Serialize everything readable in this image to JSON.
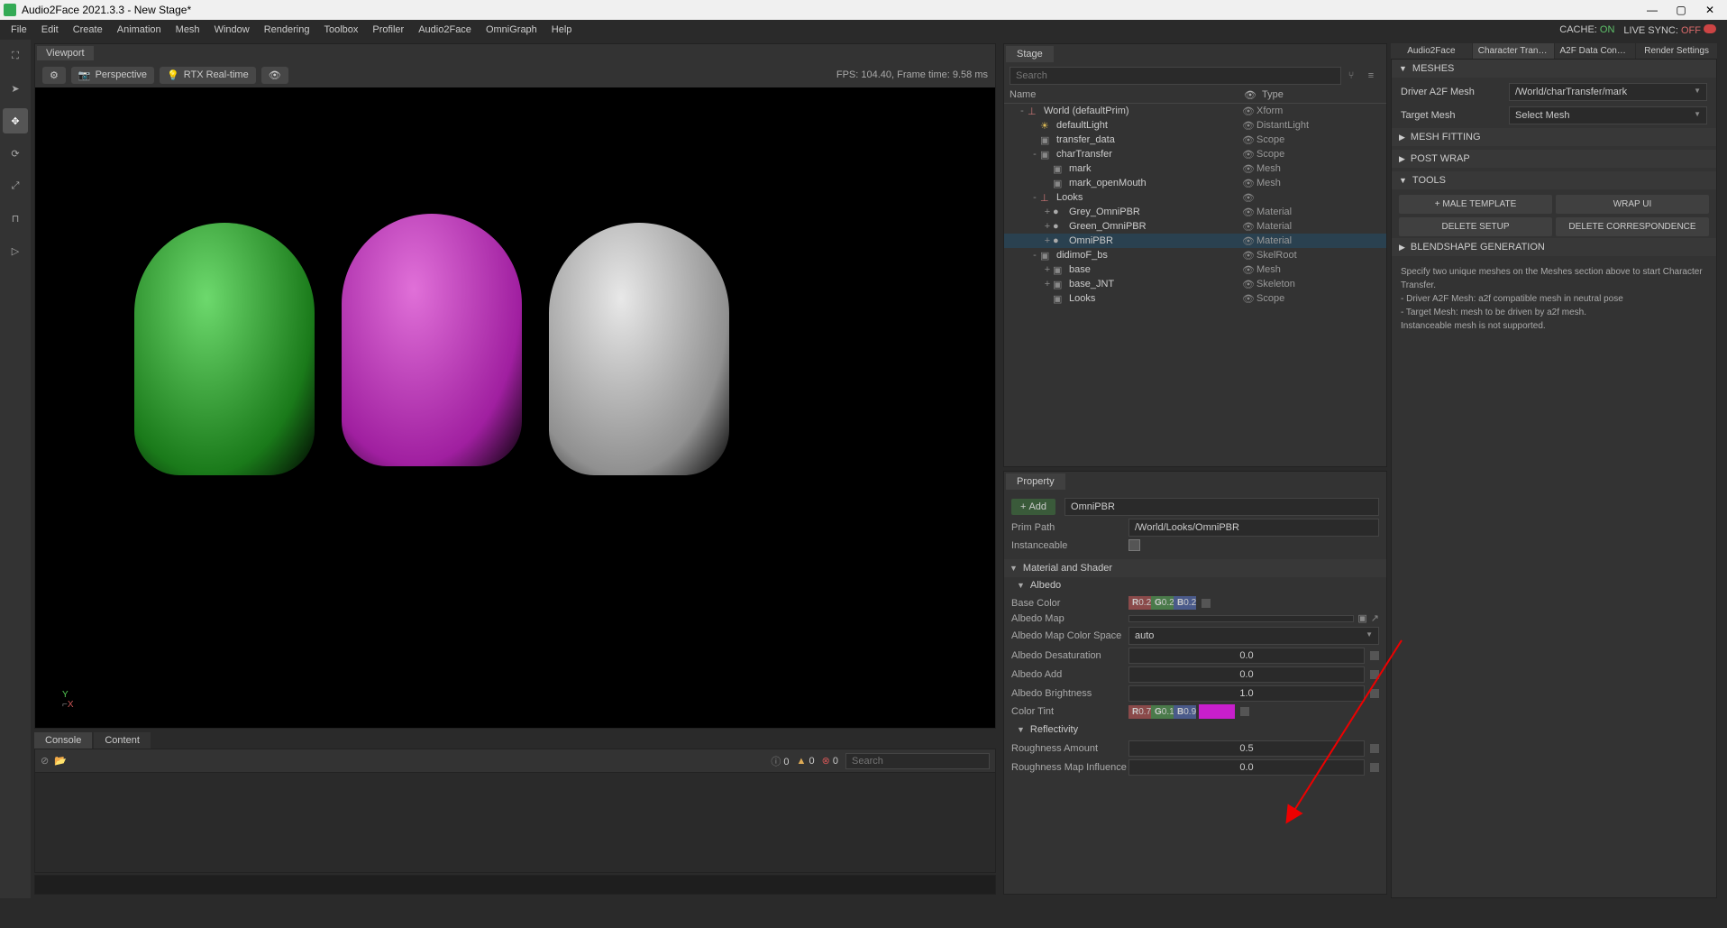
{
  "titlebar": {
    "title": "Audio2Face 2021.3.3 - New Stage*"
  },
  "menubar": {
    "items": [
      "File",
      "Edit",
      "Create",
      "Animation",
      "Mesh",
      "Window",
      "Rendering",
      "Toolbox",
      "Profiler",
      "Audio2Face",
      "OmniGraph",
      "Help"
    ],
    "cache_label": "CACHE:",
    "cache_value": "ON",
    "livesync_label": "LIVE SYNC:",
    "livesync_value": "OFF"
  },
  "viewport": {
    "tab": "Viewport",
    "perspective": "Perspective",
    "rtx": "RTX Real-time",
    "stats": "FPS: 104.40, Frame time: 9.58 ms",
    "axis_y": "Y",
    "axis_x": "X"
  },
  "console": {
    "tabs": [
      "Console",
      "Content"
    ],
    "info_count": "0",
    "warn_count": "0",
    "err_count": "0",
    "search_placeholder": "Search"
  },
  "stage": {
    "tab": "Stage",
    "search_placeholder": "Search",
    "headers": {
      "name": "Name",
      "type": "Type"
    },
    "tree": [
      {
        "depth": 0,
        "expand": "-",
        "icon": "xform",
        "label": "World (defaultPrim)",
        "type": "Xform"
      },
      {
        "depth": 1,
        "expand": "",
        "icon": "light",
        "label": "defaultLight",
        "type": "DistantLight"
      },
      {
        "depth": 1,
        "expand": "",
        "icon": "folder",
        "label": "transfer_data",
        "type": "Scope"
      },
      {
        "depth": 1,
        "expand": "-",
        "icon": "folder",
        "label": "charTransfer",
        "type": "Scope"
      },
      {
        "depth": 2,
        "expand": "",
        "icon": "mesh",
        "label": "mark",
        "type": "Mesh"
      },
      {
        "depth": 2,
        "expand": "",
        "icon": "mesh",
        "label": "mark_openMouth",
        "type": "Mesh"
      },
      {
        "depth": 1,
        "expand": "-",
        "icon": "xform",
        "label": "Looks",
        "type": ""
      },
      {
        "depth": 2,
        "expand": "+",
        "icon": "mat",
        "label": "Grey_OmniPBR",
        "type": "Material"
      },
      {
        "depth": 2,
        "expand": "+",
        "icon": "mat",
        "label": "Green_OmniPBR",
        "type": "Material"
      },
      {
        "depth": 2,
        "expand": "+",
        "icon": "mat",
        "label": "OmniPBR",
        "type": "Material",
        "selected": true
      },
      {
        "depth": 1,
        "expand": "-",
        "icon": "skel",
        "label": "didimoF_bs",
        "type": "SkelRoot"
      },
      {
        "depth": 2,
        "expand": "+",
        "icon": "mesh",
        "label": "base",
        "type": "Mesh"
      },
      {
        "depth": 2,
        "expand": "+",
        "icon": "mesh",
        "label": "base_JNT",
        "type": "Skeleton"
      },
      {
        "depth": 2,
        "expand": "",
        "icon": "folder",
        "label": "Looks",
        "type": "Scope"
      }
    ]
  },
  "property": {
    "tab": "Property",
    "add": "Add",
    "name_value": "OmniPBR",
    "primpath_label": "Prim Path",
    "primpath_value": "/World/Looks/OmniPBR",
    "instanceable_label": "Instanceable",
    "section_matshader": "Material and Shader",
    "section_albedo": "Albedo",
    "base_color_label": "Base Color",
    "base_color": {
      "r": "0.2",
      "g": "0.2",
      "b": "0.2"
    },
    "albedo_map_label": "Albedo Map",
    "albedo_colorspace_label": "Albedo Map Color Space",
    "albedo_colorspace_value": "auto",
    "albedo_desat_label": "Albedo Desaturation",
    "albedo_desat_value": "0.0",
    "albedo_add_label": "Albedo Add",
    "albedo_add_value": "0.0",
    "albedo_bright_label": "Albedo Brightness",
    "albedo_bright_value": "1.0",
    "color_tint_label": "Color Tint",
    "color_tint": {
      "r": "0.7",
      "g": "0.1",
      "b": "0.9",
      "swatch": "#c81fcc"
    },
    "section_reflectivity": "Reflectivity",
    "roughness_amount_label": "Roughness Amount",
    "roughness_amount_value": "0.5",
    "roughness_map_inf_label": "Roughness Map Influence",
    "roughness_map_inf_value": "0.0"
  },
  "chartransfer": {
    "tabs": [
      "Audio2Face",
      "Character Transf...",
      "A2F Data Conver...",
      "Render Settings"
    ],
    "section_meshes": "MESHES",
    "driver_label": "Driver A2F Mesh",
    "driver_value": "/World/charTransfer/mark",
    "target_label": "Target Mesh",
    "target_value": "Select Mesh",
    "section_fitting": "MESH FITTING",
    "section_postwrap": "POST WRAP",
    "section_tools": "TOOLS",
    "btn_male": "MALE TEMPLATE",
    "btn_wrap": "WRAP UI",
    "btn_delsetup": "DELETE SETUP",
    "btn_delcorr": "DELETE CORRESPONDENCE",
    "section_blendshape": "BLENDSHAPE GENERATION",
    "help_text": "Specify two unique meshes on the Meshes section above to start Character Transfer.\n- Driver A2F Mesh: a2f compatible mesh in neutral pose\n- Target Mesh: mesh to be driven by a2f mesh.\nInstanceable mesh is not supported."
  }
}
